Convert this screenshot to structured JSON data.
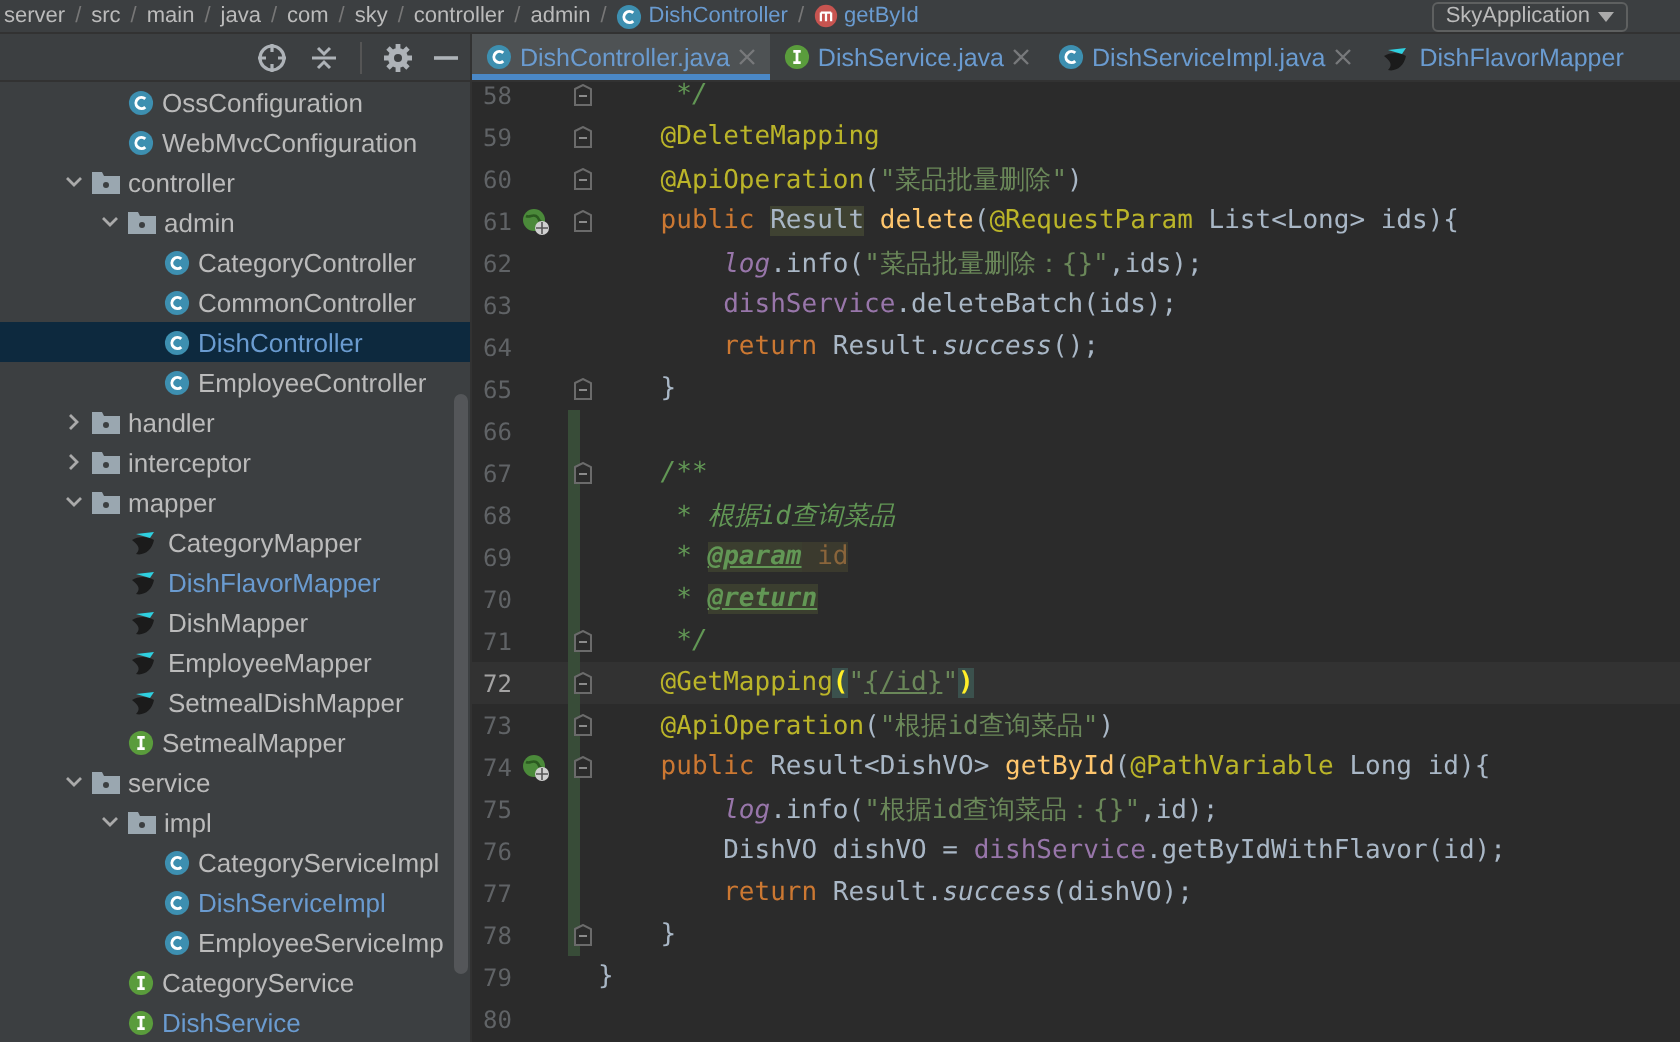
{
  "breadcrumb": {
    "separator": "/",
    "items": [
      {
        "label": "server",
        "kind": "folder"
      },
      {
        "label": "src",
        "kind": "folder"
      },
      {
        "label": "main",
        "kind": "folder"
      },
      {
        "label": "java",
        "kind": "folder"
      },
      {
        "label": "com",
        "kind": "folder"
      },
      {
        "label": "sky",
        "kind": "folder"
      },
      {
        "label": "controller",
        "kind": "folder"
      },
      {
        "label": "admin",
        "kind": "folder"
      },
      {
        "label": "DishController",
        "kind": "class"
      },
      {
        "label": "getById",
        "kind": "method"
      }
    ]
  },
  "run_config": {
    "label": "SkyApplication"
  },
  "tree": {
    "continued": [
      {
        "label": "OssConfiguration",
        "kind": "class",
        "selected": false,
        "modified": false
      },
      {
        "label": "WebMvcConfiguration",
        "kind": "class",
        "selected": false,
        "modified": false
      }
    ],
    "items": [
      {
        "label": "controller",
        "kind": "folder",
        "expanded": true,
        "children": [
          {
            "label": "admin",
            "kind": "folder",
            "expanded": true,
            "children": [
              {
                "label": "CategoryController",
                "kind": "class",
                "selected": false,
                "modified": false
              },
              {
                "label": "CommonController",
                "kind": "class",
                "selected": false,
                "modified": false
              },
              {
                "label": "DishController",
                "kind": "class",
                "selected": true,
                "modified": true
              },
              {
                "label": "EmployeeController",
                "kind": "class",
                "selected": false,
                "modified": false
              }
            ]
          }
        ]
      },
      {
        "label": "handler",
        "kind": "folder",
        "expanded": false
      },
      {
        "label": "interceptor",
        "kind": "folder",
        "expanded": false
      },
      {
        "label": "mapper",
        "kind": "folder",
        "expanded": true,
        "children": [
          {
            "label": "CategoryMapper",
            "kind": "mapper",
            "selected": false,
            "modified": false
          },
          {
            "label": "DishFlavorMapper",
            "kind": "mapper",
            "selected": false,
            "modified": true
          },
          {
            "label": "DishMapper",
            "kind": "mapper",
            "selected": false,
            "modified": false
          },
          {
            "label": "EmployeeMapper",
            "kind": "mapper",
            "selected": false,
            "modified": false
          },
          {
            "label": "SetmealDishMapper",
            "kind": "mapper",
            "selected": false,
            "modified": false
          },
          {
            "label": "SetmealMapper",
            "kind": "interface",
            "selected": false,
            "modified": false
          }
        ]
      },
      {
        "label": "service",
        "kind": "folder",
        "expanded": true,
        "children": [
          {
            "label": "impl",
            "kind": "folder",
            "expanded": true,
            "children": [
              {
                "label": "CategoryServiceImpl",
                "kind": "class",
                "selected": false,
                "modified": false
              },
              {
                "label": "DishServiceImpl",
                "kind": "class",
                "selected": false,
                "modified": true
              },
              {
                "label": "EmployeeServiceImp",
                "kind": "class",
                "selected": false,
                "modified": false
              }
            ]
          },
          {
            "label": "CategoryService",
            "kind": "interface",
            "selected": false,
            "modified": false
          },
          {
            "label": "DishService",
            "kind": "interface",
            "selected": false,
            "modified": true
          }
        ]
      }
    ]
  },
  "tabs": [
    {
      "label": "DishController.java",
      "kind": "class",
      "selected": true,
      "closable": true
    },
    {
      "label": "DishService.java",
      "kind": "interface",
      "selected": false,
      "closable": true
    },
    {
      "label": "DishServiceImpl.java",
      "kind": "class",
      "selected": false,
      "closable": true
    },
    {
      "label": "DishFlavorMapper",
      "kind": "mapper",
      "selected": false,
      "closable": false
    }
  ],
  "editor": {
    "lines": [
      {
        "number": "58",
        "fold": true,
        "endpoint": false,
        "changed": false,
        "current": false,
        "kind": "doc",
        "tokens": [
          {
            "kind": "comment",
            "text": "*/"
          }
        ]
      },
      {
        "number": "59",
        "fold": true,
        "endpoint": false,
        "changed": false,
        "current": false,
        "kind": "member",
        "tokens": [
          {
            "kind": "ann",
            "text": "@DeleteMapping"
          }
        ]
      },
      {
        "number": "60",
        "fold": true,
        "endpoint": false,
        "changed": false,
        "current": false,
        "kind": "member",
        "tokens": [
          {
            "kind": "ann",
            "text": "@ApiOperation"
          },
          {
            "kind": "plain",
            "text": "("
          },
          {
            "kind": "str",
            "text": "\"菜品批量删除\""
          },
          {
            "kind": "plain",
            "text": ")"
          }
        ]
      },
      {
        "number": "61",
        "fold": true,
        "endpoint": true,
        "changed": false,
        "current": false,
        "kind": "member",
        "tokens": [
          {
            "kind": "kw",
            "text": "public "
          },
          {
            "kind": "hl",
            "text": "Result"
          },
          {
            "kind": "method",
            "text": " delete"
          },
          {
            "kind": "plain",
            "text": "("
          },
          {
            "kind": "ann",
            "text": "@RequestParam"
          },
          {
            "kind": "plain",
            "text": " List<Long> ids){"
          }
        ]
      },
      {
        "number": "62",
        "fold": false,
        "endpoint": false,
        "changed": false,
        "current": false,
        "kind": "body",
        "tokens": [
          {
            "kind": "static-field",
            "text": "log"
          },
          {
            "kind": "plain",
            "text": ".info("
          },
          {
            "kind": "str",
            "text": "\"菜品批量删除：{}\""
          },
          {
            "kind": "plain",
            "text": ",ids);"
          }
        ]
      },
      {
        "number": "63",
        "fold": false,
        "endpoint": false,
        "changed": false,
        "current": false,
        "kind": "body",
        "tokens": [
          {
            "kind": "field",
            "text": "dishService"
          },
          {
            "kind": "plain",
            "text": ".deleteBatch(ids);"
          }
        ]
      },
      {
        "number": "64",
        "fold": false,
        "endpoint": false,
        "changed": false,
        "current": false,
        "kind": "body",
        "tokens": [
          {
            "kind": "kw",
            "text": "return "
          },
          {
            "kind": "plain",
            "text": "Result."
          },
          {
            "kind": "static",
            "text": "success"
          },
          {
            "kind": "plain",
            "text": "();"
          }
        ]
      },
      {
        "number": "65",
        "fold": true,
        "endpoint": false,
        "changed": false,
        "current": false,
        "kind": "member",
        "tokens": [
          {
            "kind": "plain",
            "text": "}"
          }
        ]
      },
      {
        "number": "66",
        "fold": false,
        "endpoint": false,
        "changed": true,
        "current": false
      },
      {
        "number": "67",
        "fold": true,
        "endpoint": false,
        "changed": true,
        "current": false,
        "kind": "member",
        "tokens": [
          {
            "kind": "comment",
            "text": "/**"
          }
        ]
      },
      {
        "number": "68",
        "fold": false,
        "endpoint": false,
        "changed": true,
        "current": false,
        "kind": "doc",
        "tokens": [
          {
            "kind": "comment",
            "text": "* 根据id查询菜品"
          }
        ]
      },
      {
        "number": "69",
        "fold": false,
        "endpoint": false,
        "changed": true,
        "current": false,
        "kind": "doc",
        "tokens": [
          {
            "kind": "comment",
            "text": "* "
          },
          {
            "kind": "doctag",
            "text": "@param"
          },
          {
            "kind": "docref",
            "text": " id"
          }
        ]
      },
      {
        "number": "70",
        "fold": false,
        "endpoint": false,
        "changed": true,
        "current": false,
        "kind": "doc",
        "tokens": [
          {
            "kind": "comment",
            "text": "* "
          },
          {
            "kind": "doctag",
            "text": "@return"
          }
        ]
      },
      {
        "number": "71",
        "fold": true,
        "endpoint": false,
        "changed": true,
        "current": false,
        "kind": "doc",
        "tokens": [
          {
            "kind": "comment",
            "text": "*/"
          }
        ]
      },
      {
        "number": "72",
        "fold": true,
        "endpoint": false,
        "changed": true,
        "current": true,
        "kind": "member",
        "tokens": [
          {
            "kind": "ann",
            "text": "@GetMapping"
          },
          {
            "kind": "match",
            "text": "("
          },
          {
            "kind": "str",
            "text": "\""
          },
          {
            "kind": "link",
            "text": "{/id}"
          },
          {
            "kind": "str",
            "text": "\""
          },
          {
            "kind": "match",
            "text": ")"
          }
        ]
      },
      {
        "number": "73",
        "fold": true,
        "endpoint": false,
        "changed": true,
        "current": false,
        "kind": "member",
        "tokens": [
          {
            "kind": "ann",
            "text": "@ApiOperation"
          },
          {
            "kind": "plain",
            "text": "("
          },
          {
            "kind": "str",
            "text": "\"根据id查询菜品\""
          },
          {
            "kind": "plain",
            "text": ")"
          }
        ]
      },
      {
        "number": "74",
        "fold": true,
        "endpoint": true,
        "changed": true,
        "current": false,
        "kind": "member",
        "tokens": [
          {
            "kind": "kw",
            "text": "public "
          },
          {
            "kind": "plain",
            "text": "Result<DishVO> "
          },
          {
            "kind": "method",
            "text": "getById"
          },
          {
            "kind": "plain",
            "text": "("
          },
          {
            "kind": "ann",
            "text": "@PathVariable"
          },
          {
            "kind": "plain",
            "text": " Long id){"
          }
        ]
      },
      {
        "number": "75",
        "fold": false,
        "endpoint": false,
        "changed": true,
        "current": false,
        "kind": "body",
        "tokens": [
          {
            "kind": "static-field",
            "text": "log"
          },
          {
            "kind": "plain",
            "text": ".info("
          },
          {
            "kind": "str",
            "text": "\"根据id查询菜品：{}\""
          },
          {
            "kind": "plain",
            "text": ",id);"
          }
        ]
      },
      {
        "number": "76",
        "fold": false,
        "endpoint": false,
        "changed": true,
        "current": false,
        "kind": "body",
        "tokens": [
          {
            "kind": "plain",
            "text": "DishVO dishVO = "
          },
          {
            "kind": "field",
            "text": "dishService"
          },
          {
            "kind": "plain",
            "text": ".getByIdWithFlavor(id);"
          }
        ]
      },
      {
        "number": "77",
        "fold": false,
        "endpoint": false,
        "changed": true,
        "current": false,
        "kind": "body",
        "tokens": [
          {
            "kind": "kw",
            "text": "return "
          },
          {
            "kind": "plain",
            "text": "Result."
          },
          {
            "kind": "static",
            "text": "success"
          },
          {
            "kind": "plain",
            "text": "(dishVO);"
          }
        ]
      },
      {
        "number": "78",
        "fold": true,
        "endpoint": false,
        "changed": true,
        "current": false,
        "kind": "member",
        "tokens": [
          {
            "kind": "plain",
            "text": "}"
          }
        ]
      },
      {
        "number": "79",
        "fold": false,
        "endpoint": false,
        "changed": false,
        "current": false,
        "kind": "top",
        "tokens": [
          {
            "kind": "plain",
            "text": "}"
          }
        ]
      },
      {
        "number": "80",
        "fold": false,
        "endpoint": false,
        "changed": false,
        "current": false
      }
    ]
  }
}
